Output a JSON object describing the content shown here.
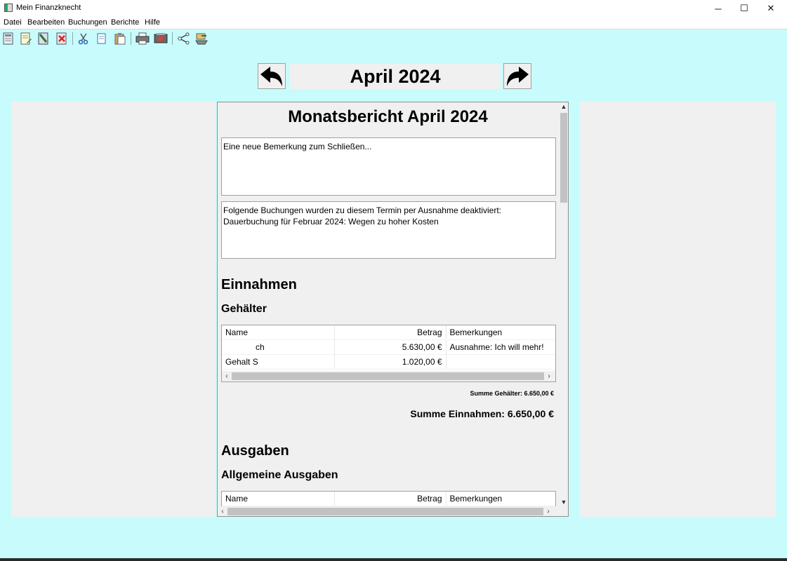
{
  "window": {
    "title": "Mein Finanzknecht",
    "minimize": "─",
    "maximize": "☐",
    "close": "✕"
  },
  "menu": [
    "Datei",
    "Bearbeiten",
    "Buchungen",
    "Berichte",
    "Hilfe"
  ],
  "toolbar_icons": [
    "new-document-icon",
    "edit-document-icon",
    "book-icon",
    "delete-icon",
    "cut-icon",
    "copy-icon",
    "paste-icon",
    "print-icon",
    "report-icon",
    "share-icon",
    "export-icon"
  ],
  "navigation": {
    "month": "April 2024"
  },
  "report": {
    "title": "Monatsbericht April 2024",
    "note": "Eine neue Bemerkung zum Schließen...",
    "deactivated_line1": "Folgende Buchungen wurden zu diesem Termin per Ausnahme deaktiviert:",
    "deactivated_line2": "Dauerbuchung für Februar 2024: Wegen zu hoher Kosten",
    "income_heading": "Einnahmen",
    "salary_heading": "Gehälter",
    "columns": {
      "name": "Name",
      "amount": "Betrag",
      "remarks": "Bemerkungen"
    },
    "salary_rows": [
      {
        "name": "ch",
        "amount": "5.630,00 €",
        "remarks": "Ausnahme: Ich will mehr!"
      },
      {
        "name": "Gehalt S",
        "amount": "1.020,00 €",
        "remarks": ""
      }
    ],
    "salary_sum": "Summe Gehälter: 6.650,00 €",
    "income_sum": "Summe Einnahmen: 6.650,00 €",
    "expenses_heading": "Ausgaben",
    "general_expenses_heading": "Allgemeine Ausgaben"
  }
}
